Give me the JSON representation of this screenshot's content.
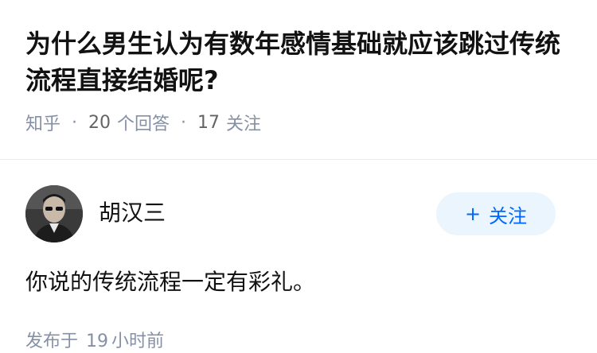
{
  "question": {
    "title": "为什么男生认为有数年感情基础就应该跳过传统流程直接结婚呢?",
    "source": "知乎",
    "answer_count": "20",
    "answer_label": "个回答",
    "follow_count": "17",
    "follow_label": "关注"
  },
  "answer": {
    "author_name": "胡汉三",
    "follow_button_label": "关注",
    "follow_button_icon": "plus-icon",
    "content": "你说的传统流程一定有彩礼。",
    "time_prefix": "发布于",
    "time_value": "19",
    "time_suffix": "小时前"
  },
  "colors": {
    "accent": "#0066ff",
    "button_bg": "#ebf5fd",
    "meta_text": "#8590a6",
    "divider": "#ebebeb"
  }
}
